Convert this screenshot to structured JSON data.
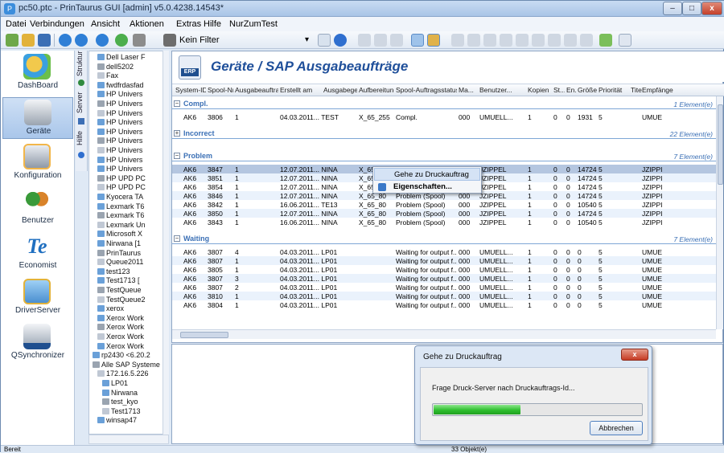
{
  "window": {
    "title": "pc50.ptc - PrinTaurus GUI [admin] v5.0.4238.14543*",
    "minimize": "–",
    "maximize": "□",
    "close": "x"
  },
  "menu": [
    "Datei",
    "Verbindungen",
    "Ansicht",
    "Aktionen",
    "Extras",
    "Hilfe",
    "NurZumTest"
  ],
  "toolbar": {
    "filter_label": "Kein Filter"
  },
  "nav": [
    "DashBoard",
    "Geräte",
    "Konfiguration",
    "Benutzer",
    "Economist",
    "DriverServer",
    "QSynchronizer"
  ],
  "vtabs": [
    "Struktur",
    "Server",
    "Hilfe"
  ],
  "tree": {
    "items": [
      "Dell Laser F",
      "dell5202",
      "Fax",
      "fwdfrdasfad",
      "HP Univers",
      "HP Univers",
      "HP Univers",
      "HP Univers",
      "HP Univers",
      "HP Univers",
      "HP Univers",
      "HP Univers",
      "HP Univers",
      "HP UPD PC",
      "HP UPD PC",
      "Kyocera TA",
      "Lexmark T6",
      "Lexmark T6",
      "Lexmark Un",
      "Microsoft X",
      "Nirwana  [1",
      "PrinTaurus",
      "Queue2011",
      "test123",
      "Test1713  [",
      "TestQueue",
      "TestQueue2",
      "xerox",
      "Xerox Work",
      "Xerox Work",
      "Xerox Work",
      "Xerox Work",
      "rp2430 <6.20.2",
      "Alle SAP Systeme",
      "172.16.5.226",
      "LP01",
      "Nirwana",
      "test_kyo",
      "Test1713",
      "winsap47"
    ]
  },
  "page_title": "Geräte / SAP Ausgabeaufträge",
  "columns": [
    "System-ID",
    "Spool-Nr.",
    "Ausgabeauftrag...",
    "Erstellt am",
    "Ausgabegerät",
    "Aufbereitung",
    "Spool-Auftragsstatus",
    "Ma...",
    "Benutzer...",
    "Kopien",
    "St...",
    "En...",
    "Größe...",
    "Priorität",
    "Titel",
    "Empfänge"
  ],
  "groups": [
    {
      "name": "Compl.",
      "count": "1 Element(e)",
      "rows": [
        [
          "AK6",
          "3806",
          "1",
          "04.03.2011... TEST",
          "",
          "X_65_255",
          "Compl.",
          "000",
          "UMUELL...",
          "1",
          "0",
          "0",
          "1931",
          "5",
          "",
          "UMUE"
        ]
      ]
    },
    {
      "name": "Incorrect",
      "count": "22 Element(e)",
      "rows": []
    },
    {
      "name": "Problem",
      "count": "7 Element(e)",
      "rows": [
        [
          "AK6",
          "3847",
          "1",
          "12.07.2011... NINA",
          "",
          "X_65_80",
          "Problem (Spool)",
          "000",
          "JZIPPEL",
          "1",
          "0",
          "0",
          "14724",
          "5",
          "",
          "JZIPPI"
        ],
        [
          "AK6",
          "3851",
          "1",
          "12.07.2011... NINA",
          "",
          "X_65_80",
          "Problem (Spool)",
          "000",
          "JZIPPEL",
          "1",
          "0",
          "0",
          "14724",
          "5",
          "",
          "JZIPPI"
        ],
        [
          "AK6",
          "3854",
          "1",
          "12.07.2011... NINA",
          "",
          "X_65_80",
          "Problem (Spool)",
          "000",
          "JZIPPEL",
          "1",
          "0",
          "0",
          "14724",
          "5",
          "",
          "JZIPPI"
        ],
        [
          "AK6",
          "3846",
          "1",
          "12.07.2011... NINA",
          "",
          "X_65_80",
          "Problem (Spool)",
          "000",
          "JZIPPEL",
          "1",
          "0",
          "0",
          "14724",
          "5",
          "",
          "JZIPPI"
        ],
        [
          "AK6",
          "3842",
          "1",
          "16.06.2011... TE13",
          "",
          "X_65_80",
          "Problem (Spool)",
          "000",
          "JZIPPEL",
          "1",
          "0",
          "0",
          "10540",
          "5",
          "",
          "JZIPPI"
        ],
        [
          "AK6",
          "3850",
          "1",
          "12.07.2011... NINA",
          "",
          "X_65_80",
          "Problem (Spool)",
          "000",
          "JZIPPEL",
          "1",
          "0",
          "0",
          "14724",
          "5",
          "",
          "JZIPPI"
        ],
        [
          "AK6",
          "3843",
          "1",
          "16.06.2011... NINA",
          "",
          "X_65_80",
          "Problem (Spool)",
          "000",
          "JZIPPEL",
          "1",
          "0",
          "0",
          "10540",
          "5",
          "",
          "JZIPPI"
        ]
      ]
    },
    {
      "name": "Waiting",
      "count": "7 Element(e)",
      "rows": [
        [
          "AK6",
          "3807",
          "4",
          "04.03.2011... LP01",
          "",
          "",
          "Waiting for output f...",
          "000",
          "UMUELL...",
          "1",
          "0",
          "0",
          "0",
          "5",
          "",
          "UMUE"
        ],
        [
          "AK6",
          "3807",
          "1",
          "04.03.2011... LP01",
          "",
          "",
          "Waiting for output f...",
          "000",
          "UMUELL...",
          "1",
          "0",
          "0",
          "0",
          "5",
          "",
          "UMUE"
        ],
        [
          "AK6",
          "3805",
          "1",
          "04.03.2011... LP01",
          "",
          "",
          "Waiting for output f...",
          "000",
          "UMUELL...",
          "1",
          "0",
          "0",
          "0",
          "5",
          "",
          "UMUE"
        ],
        [
          "AK6",
          "3807",
          "3",
          "04.03.2011... LP01",
          "",
          "",
          "Waiting for output f...",
          "000",
          "UMUELL...",
          "1",
          "0",
          "0",
          "0",
          "5",
          "",
          "UMUE"
        ],
        [
          "AK6",
          "3807",
          "2",
          "04.03.2011... LP01",
          "",
          "",
          "Waiting for output f...",
          "000",
          "UMUELL...",
          "1",
          "0",
          "0",
          "0",
          "5",
          "",
          "UMUE"
        ],
        [
          "AK6",
          "3810",
          "1",
          "04.03.2011... LP01",
          "",
          "",
          "Waiting for output f...",
          "000",
          "UMUELL...",
          "1",
          "0",
          "0",
          "0",
          "5",
          "",
          "UMUE"
        ],
        [
          "AK6",
          "3804",
          "1",
          "04.03.2011... LP01",
          "",
          "",
          "Waiting for output f...",
          "000",
          "UMUELL...",
          "1",
          "0",
          "0",
          "0",
          "5",
          "",
          "UMUE"
        ]
      ]
    }
  ],
  "context_menu": [
    "Gehe zu Druckauftrag",
    "Eigenschaften..."
  ],
  "dialog": {
    "title": "Gehe zu Druckauftrag",
    "text": "Frage Druck-Server nach Druckauftrags-Id...",
    "progress": 0.42,
    "cancel": "Abbrechen",
    "close": "x"
  },
  "status": {
    "left": "Bereit",
    "right": "33 Objekt(e)"
  },
  "colors": {
    "accent": "#1f4f9a",
    "group": "#3a6fb5",
    "selected_row": "#b4c6e0",
    "progress": "#2fbf2f"
  }
}
